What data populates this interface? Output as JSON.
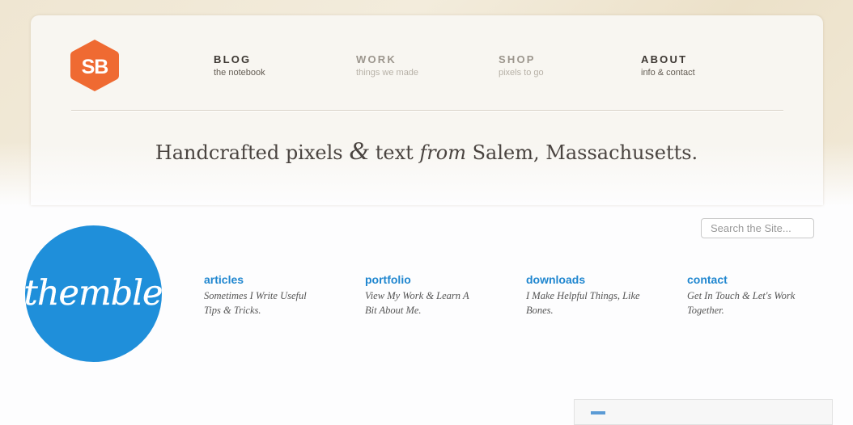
{
  "logo": {
    "text": "SB",
    "color": "#ef6a32"
  },
  "nav": [
    {
      "title": "BLOG",
      "subtitle": "the notebook"
    },
    {
      "title": "WORK",
      "subtitle": "things we made"
    },
    {
      "title": "SHOP",
      "subtitle": "pixels to go"
    },
    {
      "title": "ABOUT",
      "subtitle": "info & contact"
    }
  ],
  "tagline": {
    "part1": "Handcrafted pixels ",
    "amp": "&",
    "part2": " text ",
    "from": "from",
    "part3": " Salem, Massachusetts."
  },
  "search": {
    "placeholder": "Search the Site..."
  },
  "themble_logo": {
    "text": "themble",
    "color": "#1f8fda"
  },
  "sections": [
    {
      "title": "articles",
      "desc_line1": "Sometimes I Write Useful",
      "desc_line2": "Tips & Tricks."
    },
    {
      "title": "portfolio",
      "desc_line1": "View My Work & Learn A",
      "desc_line2": "Bit About Me."
    },
    {
      "title": "downloads",
      "desc_line1": "I Make Helpful Things, Like",
      "desc_line2": "Bones."
    },
    {
      "title": "contact",
      "desc_line1": "Get In Touch & Let's Work",
      "desc_line2": "Together."
    }
  ],
  "colors": {
    "link": "#1f86cf",
    "parchment": "#efe6d2"
  }
}
